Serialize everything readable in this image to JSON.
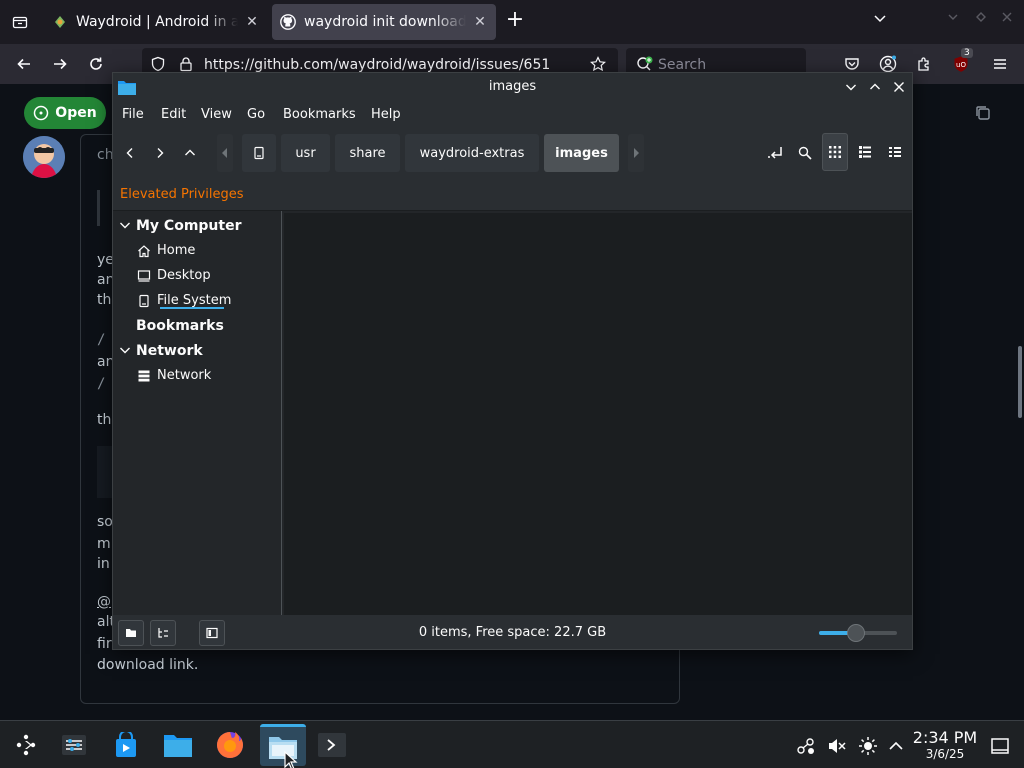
{
  "browser": {
    "tabs": [
      {
        "title": "Waydroid | Android in a Linux container",
        "active": false
      },
      {
        "title": "waydroid init download get",
        "active": true
      }
    ],
    "url": "https://github.com/waydroid/waydroid/issues/651",
    "search_placeholder": "Search",
    "ublock_badge": "3",
    "page": {
      "open_label": "Open",
      "commenter_fragment": "ch",
      "body_fragments": [
        "ye",
        "an",
        "th",
        "/",
        "an",
        "/",
        "th",
        "so",
        "m",
        "in",
        "@",
        "alt",
        "fir"
      ],
      "last_line": "download link."
    }
  },
  "dolphin": {
    "title": "images",
    "menu": [
      "File",
      "Edit",
      "View",
      "Go",
      "Bookmarks",
      "Help"
    ],
    "breadcrumbs": [
      "usr",
      "share",
      "waydroid-extras",
      "images"
    ],
    "active_crumb": "images",
    "elevated_label": "Elevated Privileges",
    "places": {
      "my_computer": "My Computer",
      "items": [
        {
          "label": "Home",
          "icon": "home-icon"
        },
        {
          "label": "Desktop",
          "icon": "desktop-icon"
        },
        {
          "label": "File System",
          "icon": "drive-icon"
        }
      ],
      "bookmarks": "Bookmarks",
      "network_header": "Network",
      "network_items": [
        {
          "label": "Network",
          "icon": "network-icon"
        }
      ]
    },
    "status": "0 items, Free space: 22.7 GB",
    "zoom": 0.48,
    "colors": {
      "accent": "#3daee9",
      "warning": "#f67400"
    }
  },
  "taskbar": {
    "apps": [
      "launcher",
      "system-settings",
      "discover",
      "dolphin",
      "firefox",
      "dolphin-active",
      "konsole"
    ],
    "clock_time": "2:34 PM",
    "clock_date": "3/6/25"
  }
}
